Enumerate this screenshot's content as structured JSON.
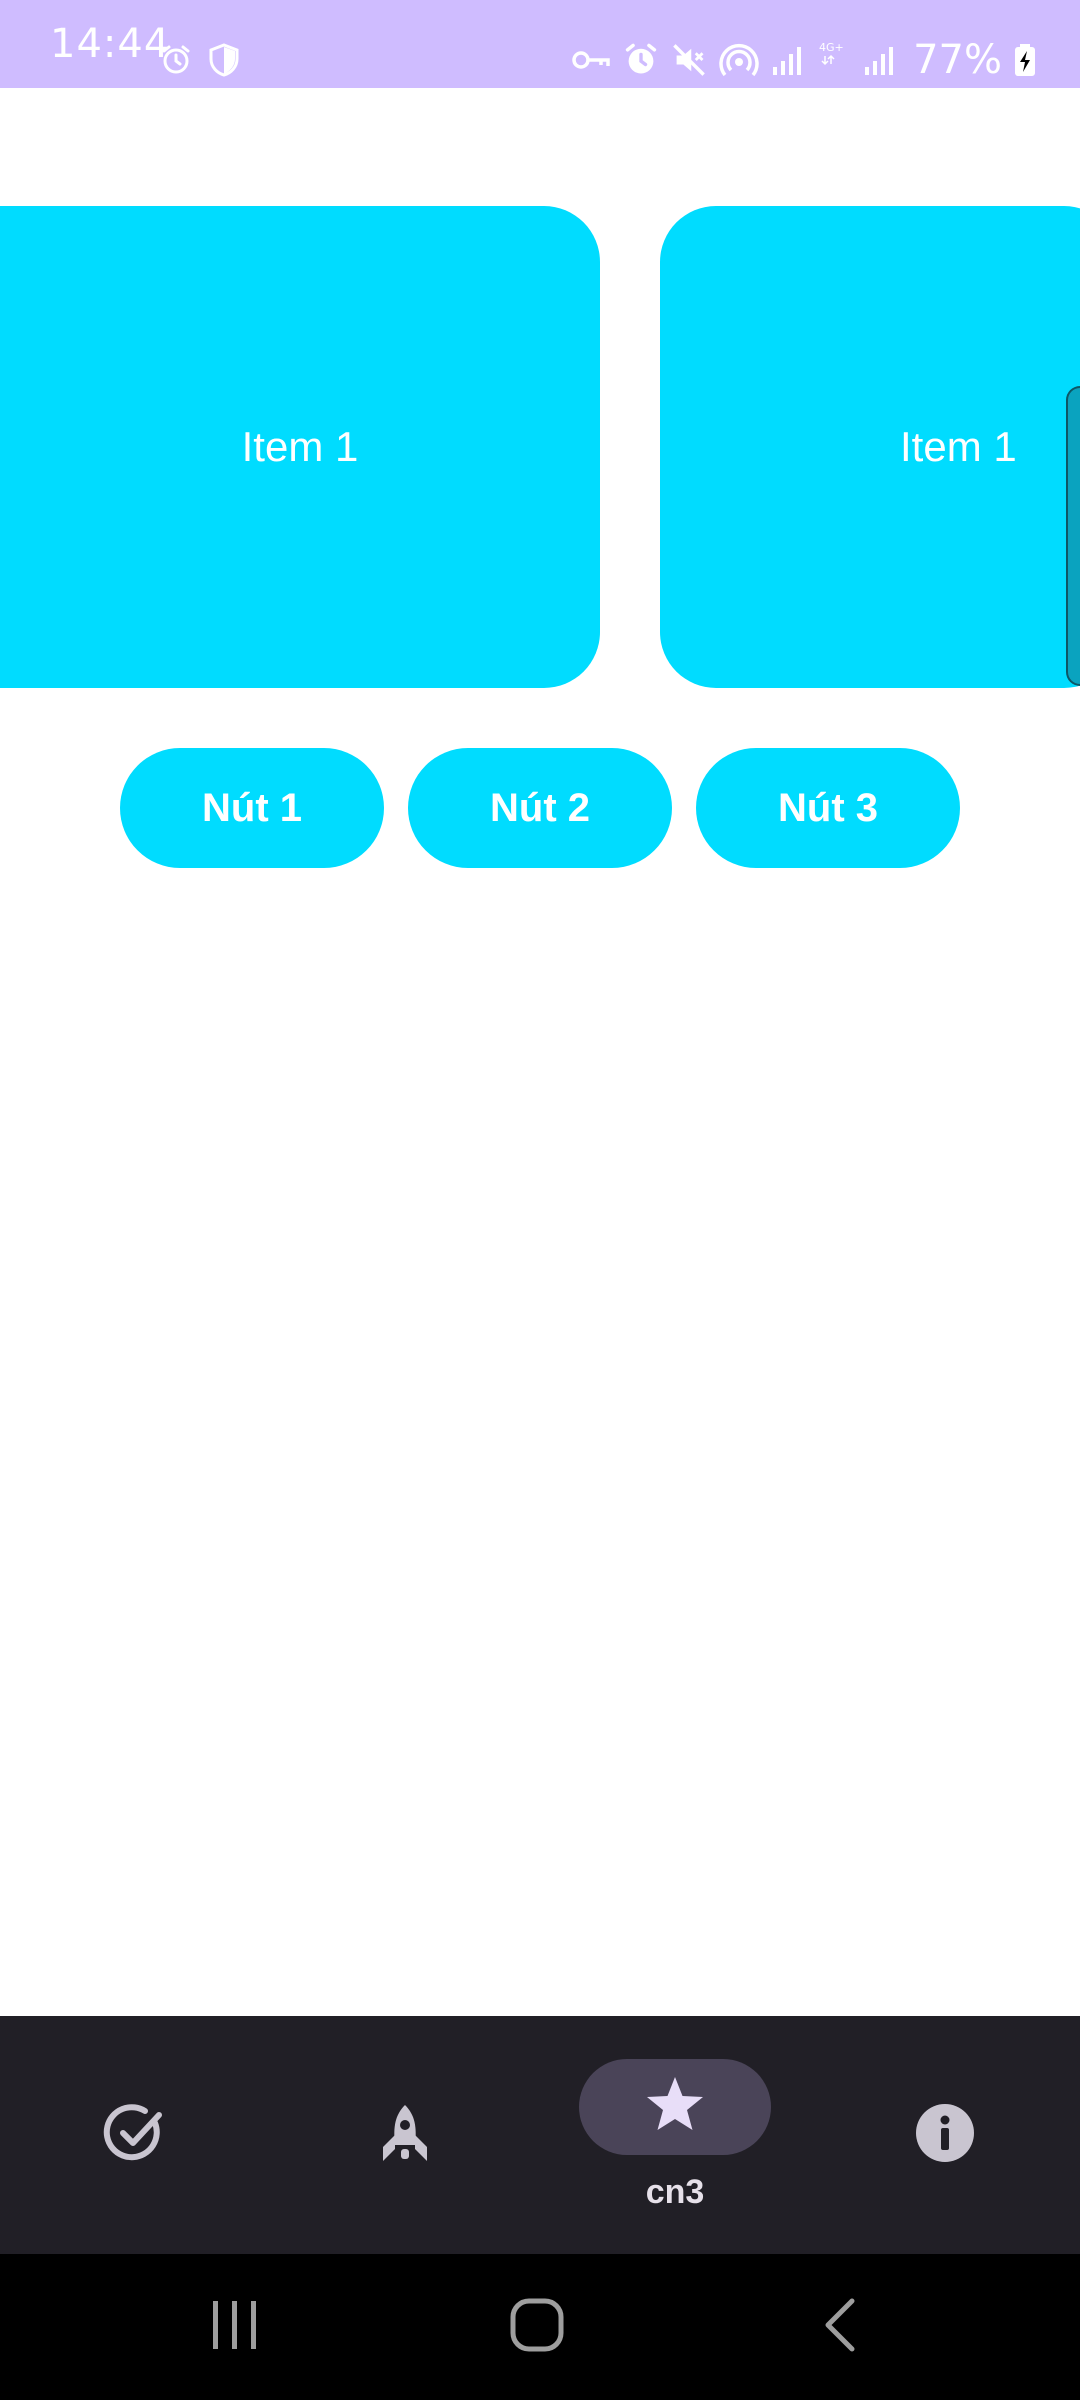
{
  "status_bar": {
    "time": "14:44",
    "battery": "77%",
    "background_color": "#cfbcff",
    "left_icons": [
      "alarm-icon",
      "shield-icon"
    ],
    "right_icons": [
      "vpn-key-icon",
      "alarm-icon",
      "mute-icon",
      "hotspot-icon",
      "signal-icon",
      "4g-signal-icon",
      "battery-charging-icon"
    ],
    "network_type": "4G+"
  },
  "carousel": {
    "items": [
      {
        "label": "Item 1"
      },
      {
        "label": "Item 1"
      }
    ],
    "card_color": "#00dcff"
  },
  "buttons": [
    {
      "label": "Nút 1"
    },
    {
      "label": "Nút 2"
    },
    {
      "label": "Nút 3"
    }
  ],
  "bottom_nav": {
    "background_color": "#211f26",
    "items": [
      {
        "icon": "check-circle-icon",
        "label": ""
      },
      {
        "icon": "rocket-icon",
        "label": ""
      },
      {
        "icon": "star-icon",
        "label": "cn3",
        "selected": true
      },
      {
        "icon": "info-icon",
        "label": ""
      }
    ]
  },
  "system_nav": {
    "buttons": [
      "recents-icon",
      "home-icon",
      "back-icon"
    ]
  }
}
